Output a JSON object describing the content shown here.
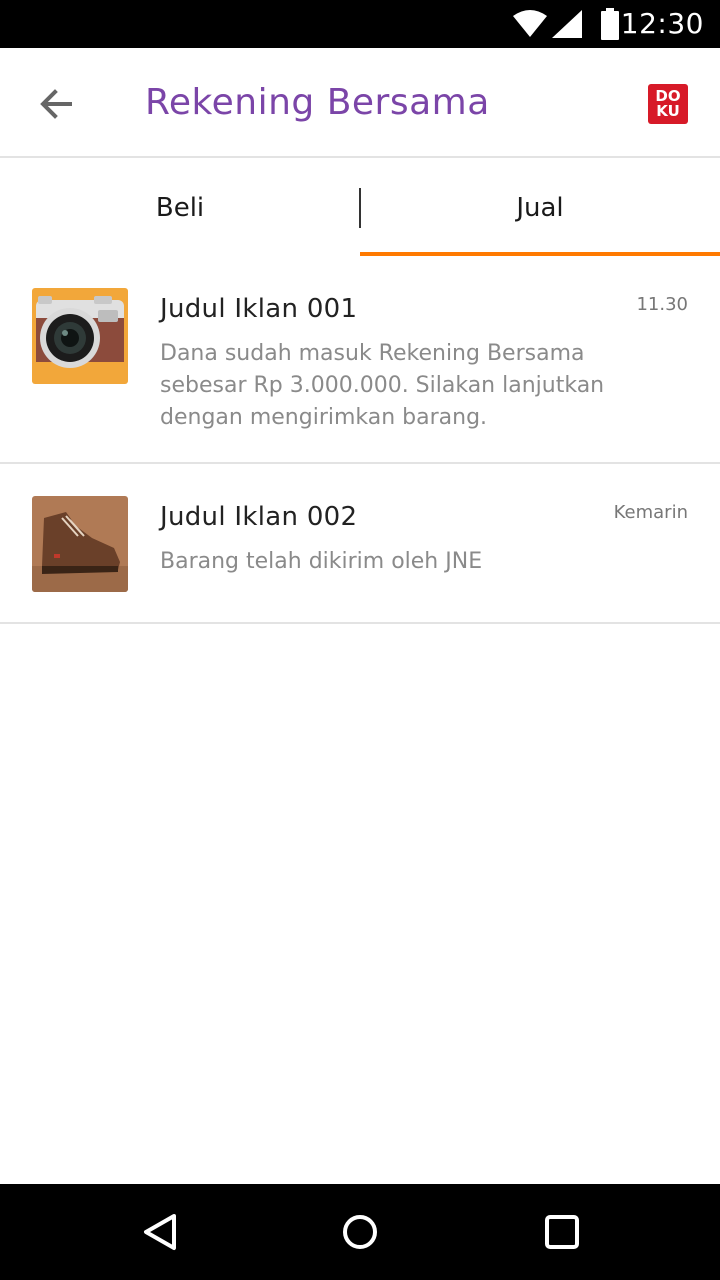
{
  "status_bar": {
    "time": "12:30"
  },
  "app_bar": {
    "title": "Rekening Bersama",
    "logo_text_top": "DO",
    "logo_text_bottom": "KU"
  },
  "tabs": [
    {
      "label": "Beli",
      "active": false
    },
    {
      "label": "Jual",
      "active": true
    }
  ],
  "colors": {
    "title": "#7b45a8",
    "tab_indicator": "#ff7a00",
    "logo_bg": "#d71a28"
  },
  "items": [
    {
      "title": "Judul Iklan 001",
      "time": "11.30",
      "body": "Dana sudah masuk Rekening Bersama sebesar Rp 3.000.000. Silakan lanjutkan dengan mengirimkan barang.",
      "thumbnail": "camera-photo"
    },
    {
      "title": "Judul Iklan 002",
      "time": "Kemarin",
      "body": "Barang telah dikirim oleh JNE",
      "thumbnail": "shoe-photo"
    }
  ]
}
